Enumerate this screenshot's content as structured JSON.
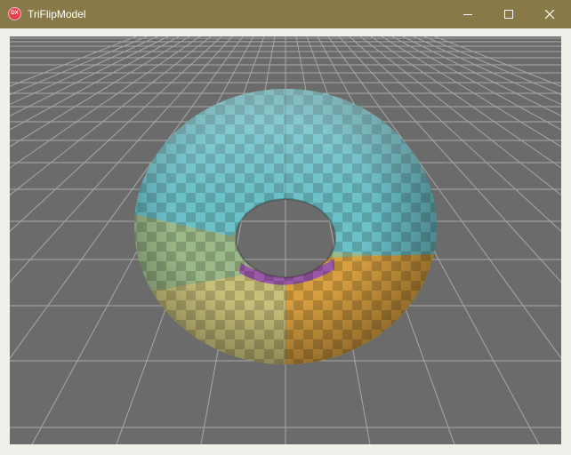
{
  "window": {
    "title": "TriFlipModel",
    "icon": "dx-app-icon",
    "controls": [
      "minimize-icon",
      "maximize-icon",
      "close-icon"
    ]
  },
  "viewport": {
    "background_color": "#6b6b6b",
    "grid_color": "#a8a8a8",
    "model": "torus",
    "model_colors": {
      "upper": "#6cc0c8",
      "left": "#9bb888",
      "lower": "#c8c07a",
      "right_lower": "#d8a040",
      "inner": "#9a58a8"
    }
  },
  "colors": {
    "titlebar": "#887a48",
    "frame": "#f1efe9"
  }
}
